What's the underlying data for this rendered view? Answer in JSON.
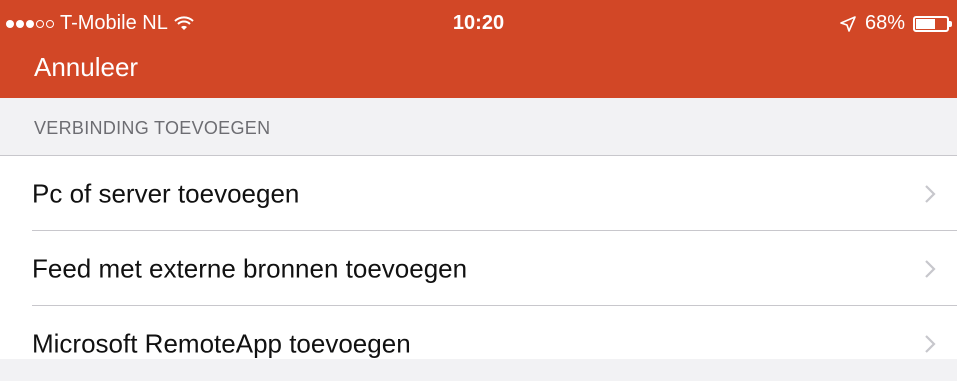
{
  "status_bar": {
    "carrier": "T-Mobile NL",
    "time": "10:20",
    "battery": "68%",
    "battery_level": 0.68
  },
  "nav": {
    "cancel_label": "Annuleer"
  },
  "section": {
    "header": "VERBINDING TOEVOEGEN"
  },
  "rows": [
    {
      "label": "Pc of server toevoegen",
      "selected": true
    },
    {
      "label": "Feed met externe bronnen toevoegen",
      "selected": false
    },
    {
      "label": "Microsoft RemoteApp toevoegen",
      "selected": false
    }
  ],
  "colors": {
    "header": "#d24726",
    "focus": "#3b3db3"
  }
}
